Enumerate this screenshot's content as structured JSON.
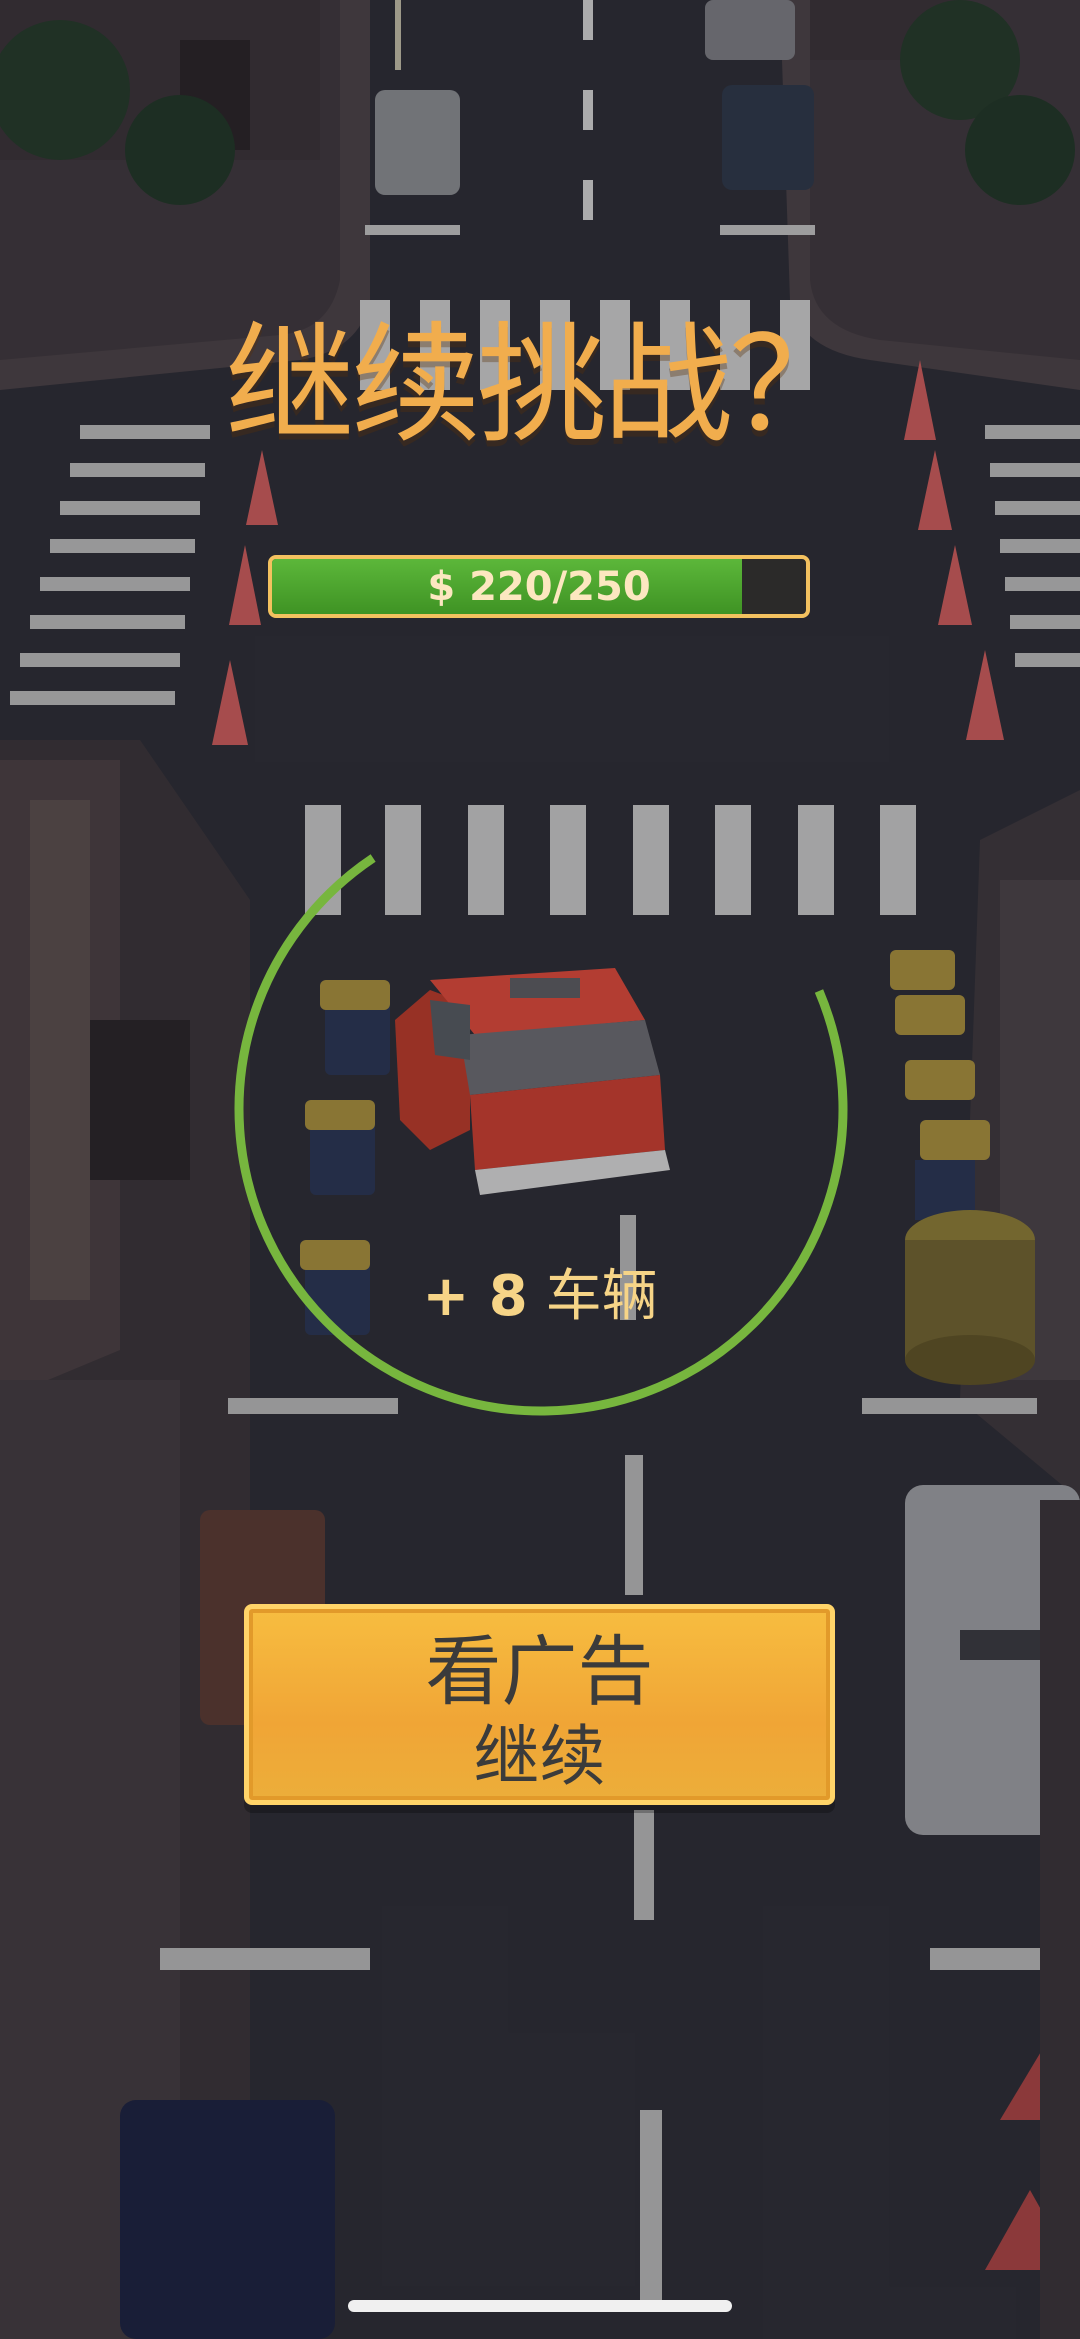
{
  "title": "继续挑战？",
  "progress": {
    "label": "$ 220/250",
    "current": 220,
    "max": 250
  },
  "countdown_ring": {
    "fraction_remaining": 0.72,
    "color": "#77b63e"
  },
  "reward": {
    "amount": "+ 8",
    "unit": "车辆"
  },
  "ad_button": {
    "line1": "看广告",
    "line2": "继续"
  },
  "colors": {
    "title": "#f1ad4d",
    "progress_fill": "#4ea62f",
    "progress_border": "#f3c15f",
    "button": "#f3b33c",
    "reward_text": "#f6d487"
  }
}
